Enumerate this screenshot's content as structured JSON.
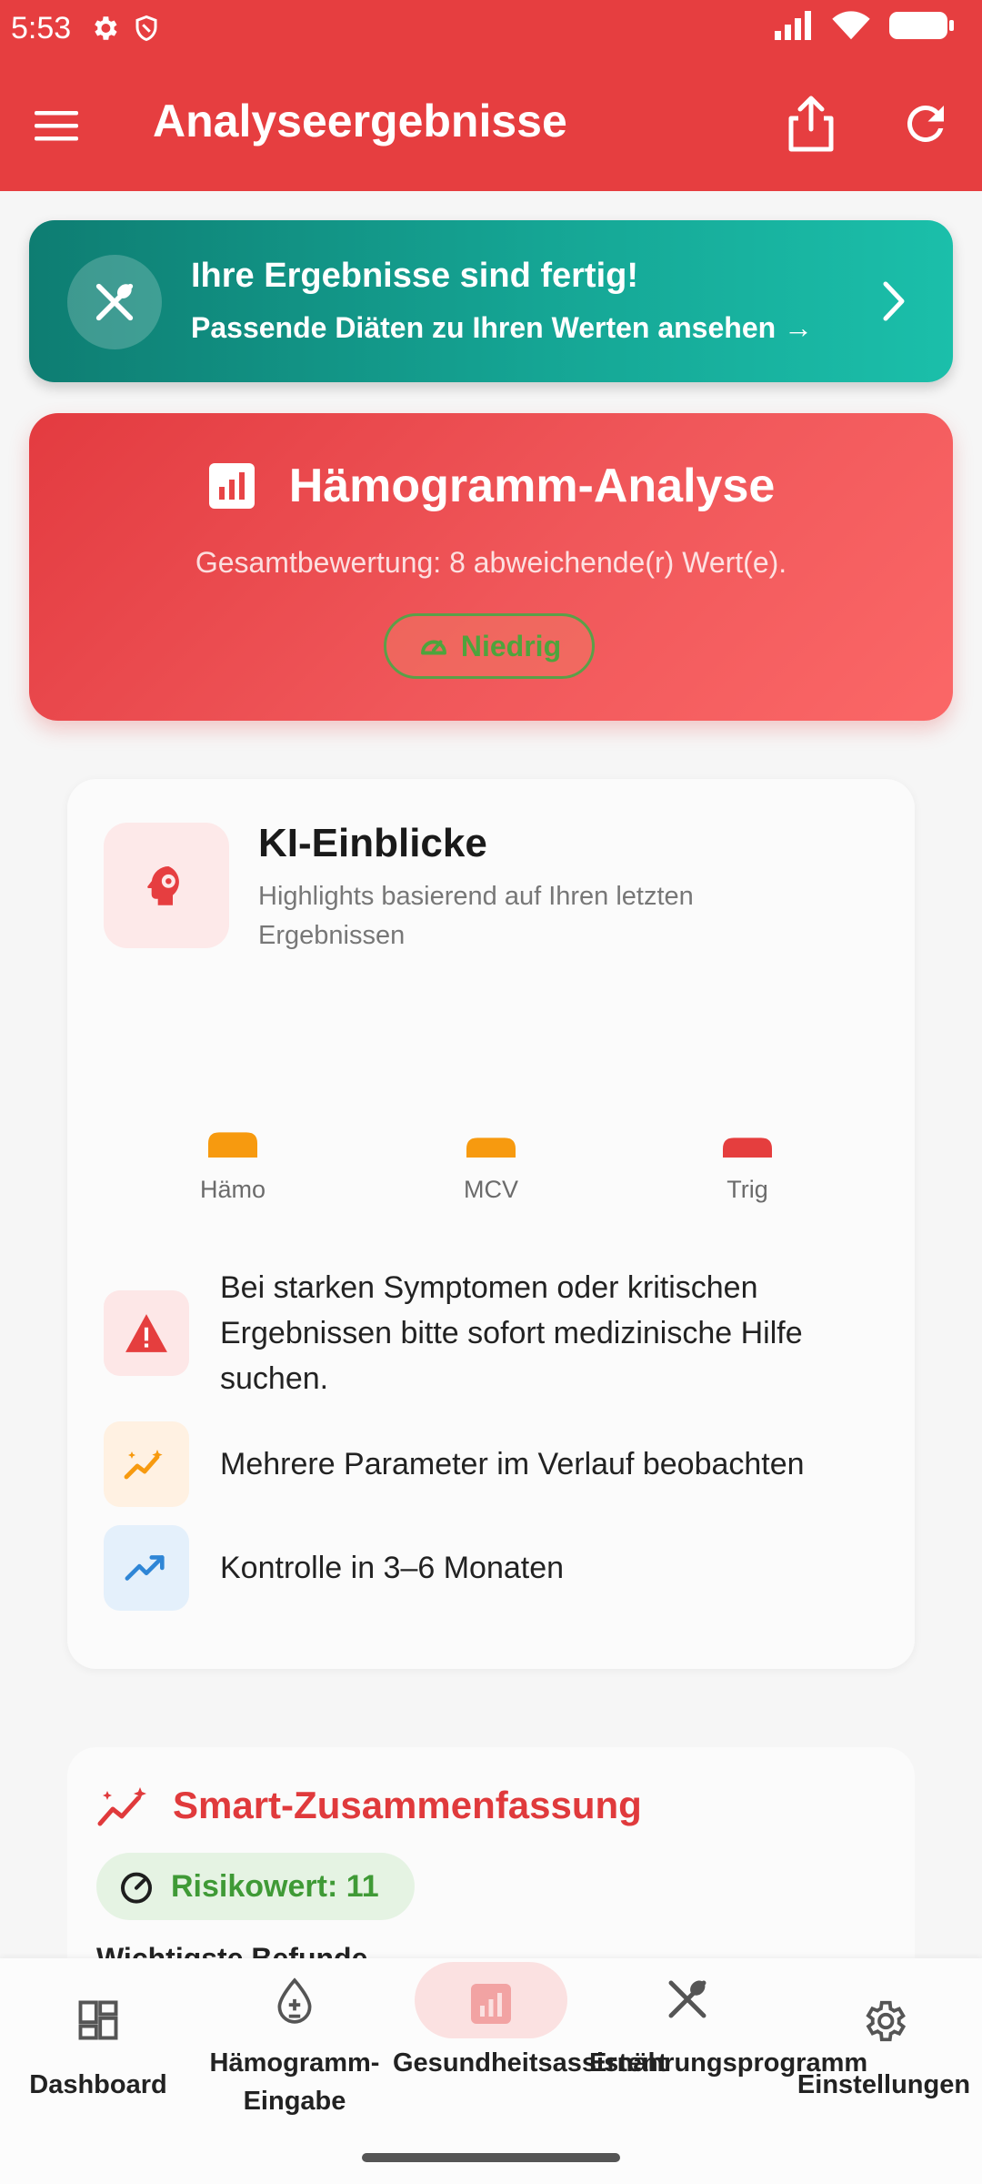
{
  "status_bar": {
    "time": "5:53"
  },
  "app_bar": {
    "title": "Analyseergebnisse"
  },
  "promo": {
    "title": "Ihre Ergebnisse sind fertig!",
    "subtitle": "Passende Diäten zu Ihren Werten ansehen →"
  },
  "hemogram": {
    "title": "Hämogramm-Analyse",
    "overall": "Gesamtbewertung: 8 abweichende(r) Wert(e).",
    "badge": "Niedrig",
    "badge_color": "#4ea43c"
  },
  "ki": {
    "title": "KI-Einblicke",
    "subtitle": "Highlights basierend auf Ihren letzten Ergebnissen",
    "insights": [
      {
        "icon": "warning-icon",
        "text": "Bei starken Symptomen oder kritischen Ergebnissen bitte sofort medizinische Hilfe suchen."
      },
      {
        "icon": "trend-sparkle-icon",
        "text": "Mehrere Parameter im Verlauf beobachten"
      },
      {
        "icon": "trending-up-icon",
        "text": "Kontrolle in 3–6 Monaten"
      }
    ]
  },
  "chart_data": {
    "type": "bar",
    "categories": [
      "Hämo",
      "MCV",
      "Trig"
    ],
    "values": [
      0.23,
      0.18,
      0.18
    ],
    "colors": [
      "#f79a0f",
      "#f79a0f",
      "#e53e3e"
    ],
    "ylim": [
      0,
      1
    ],
    "title": "",
    "xlabel": "",
    "ylabel": "",
    "grid": false
  },
  "summary": {
    "title": "Smart-Zusammenfassung",
    "risk": "Risikowert: 11",
    "key_findings": "Wichtigste Befunde"
  },
  "bottom_nav": {
    "items": [
      {
        "label": "Dashboard",
        "icon": "dashboard-icon"
      },
      {
        "label": "Hämogramm-Eingabe",
        "icon": "blood-drop-icon"
      },
      {
        "label": "Gesundheitsassistent",
        "icon": "analytics-icon",
        "active": true
      },
      {
        "label": "Ernährungsprogramm",
        "icon": "fork-spoon-icon"
      },
      {
        "label": "Einstellungen",
        "icon": "gear-icon"
      }
    ]
  },
  "colors": {
    "primary": "#e63e40",
    "teal": "#15a594",
    "green": "#4ea43c"
  }
}
